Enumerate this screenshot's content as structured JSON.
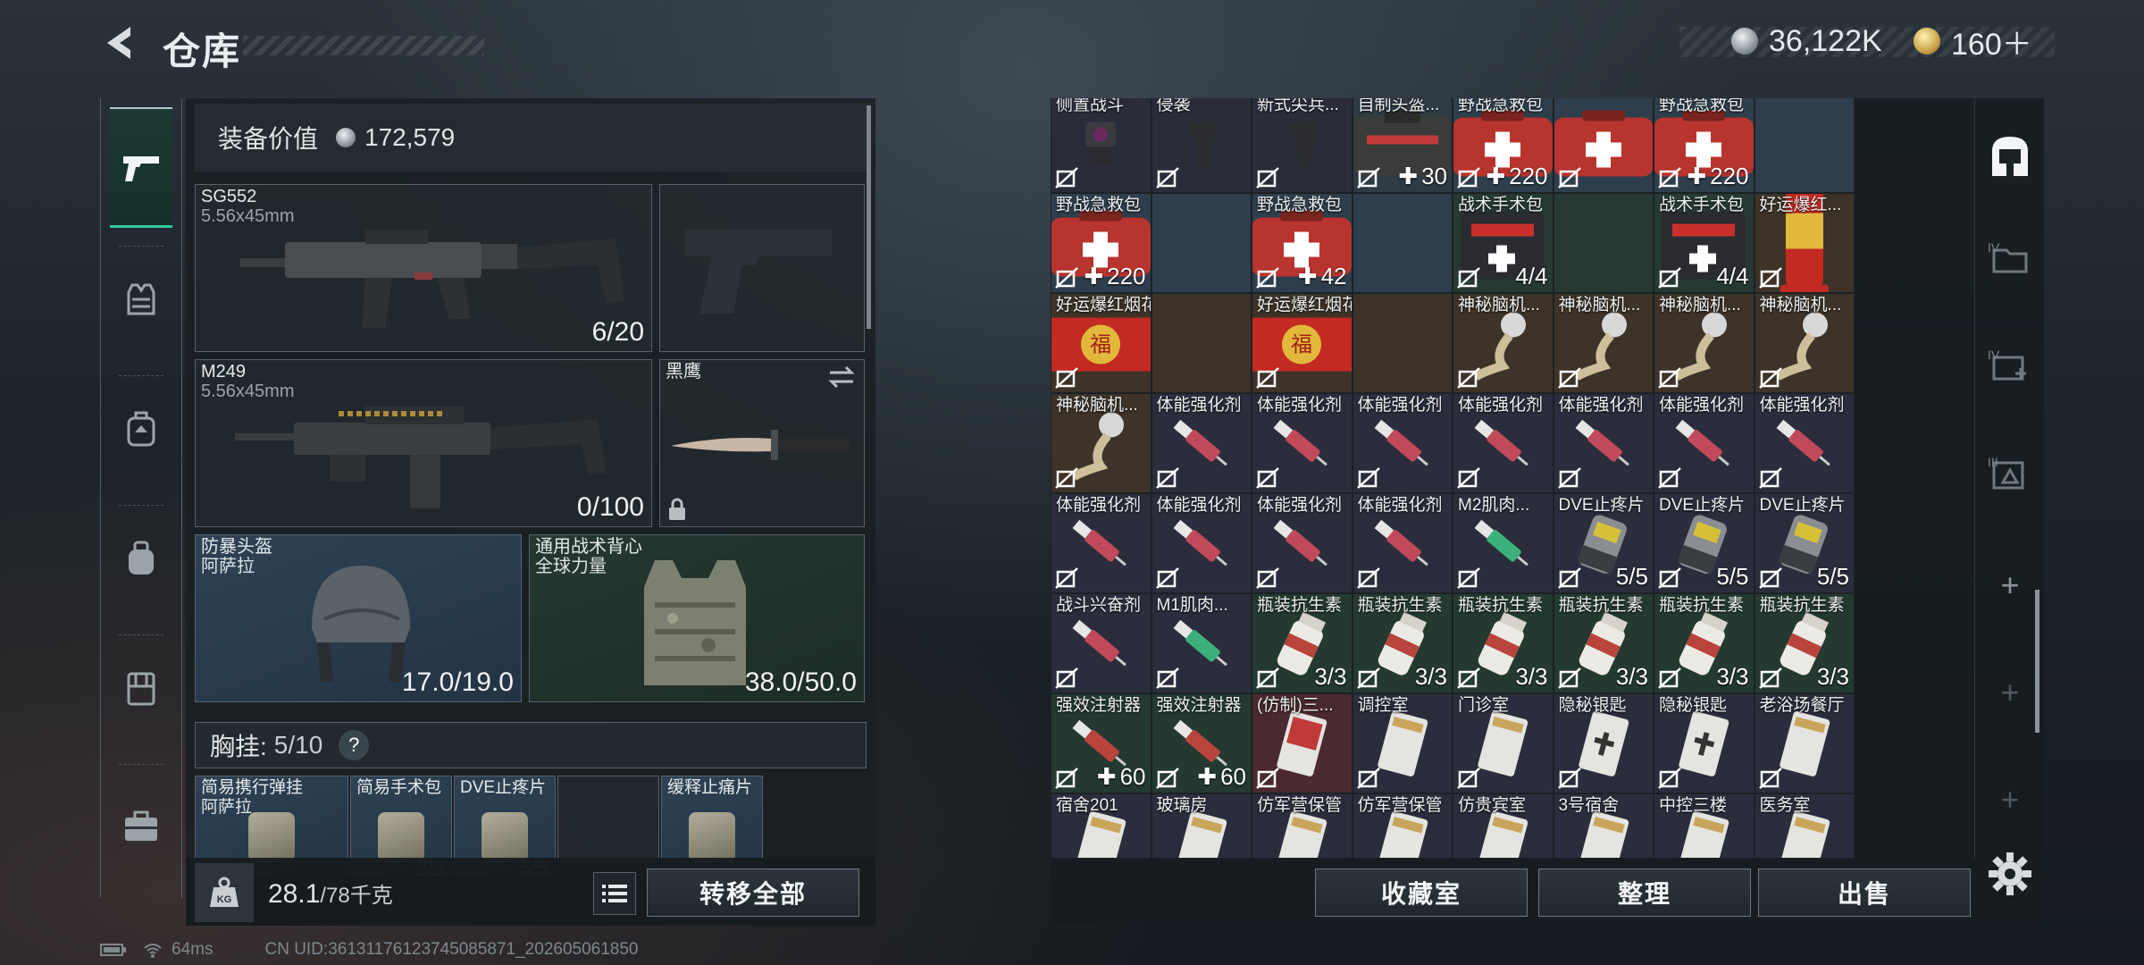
{
  "header": {
    "title": "仓库",
    "silver_amount": "36,122K",
    "gold_amount": "160＋"
  },
  "equipment": {
    "value_label": "装备价值",
    "value": "172,579",
    "primary": {
      "name": "SG552",
      "caliber": "5.56x45mm",
      "ammo": "6/20"
    },
    "secondary": {
      "name": "M249",
      "caliber": "5.56x45mm",
      "ammo": "0/100"
    },
    "melee": {
      "name": "黑鹰"
    },
    "helmet": {
      "name": "防暴头盔",
      "sub": "阿萨拉",
      "durability": "17.0/19.0"
    },
    "vest": {
      "name": "通用战术背心",
      "sub": "全球力量",
      "durability": "38.0/50.0"
    },
    "chest_rig_label": "胸挂:",
    "chest_rig_count": "5/10",
    "help": "?",
    "rig_items": [
      {
        "name": "简易携行弹挂",
        "sub": "阿萨拉",
        "count": ""
      },
      {
        "name": "简易手术包",
        "sub": "",
        "count": "2/2"
      },
      {
        "name": "DVE止疼片",
        "sub": "",
        "count": "5/5"
      },
      {
        "name": "",
        "sub": "",
        "count": ""
      },
      {
        "name": "缓释止痛片",
        "sub": "",
        "count": "1/1"
      }
    ]
  },
  "weight": {
    "current": "28.1",
    "max": "/78千克"
  },
  "buttons": {
    "transfer_all": "转移全部",
    "collection": "收藏室",
    "sort": "整理",
    "sell": "出售"
  },
  "storage_rows": [
    [
      {
        "name": "侧置战斗",
        "count": "",
        "color": "#2a2c3a",
        "icon": "scope"
      },
      {
        "name": "侵袭",
        "count": "",
        "color": "#2a2c3a",
        "icon": "grip"
      },
      {
        "name": "新式尖兵...",
        "count": "",
        "color": "#2a2c3a",
        "icon": "grip"
      },
      {
        "name": "自制头盔...",
        "count": "30",
        "color": "#2e3a44",
        "icon": "armorbag"
      },
      {
        "name": "野战急救包",
        "count": "220",
        "color": "#2e3e4c",
        "icon": "medkit"
      },
      {
        "name": "",
        "count": "",
        "color": "#2e3e4c",
        "icon": "medkit"
      },
      {
        "name": "野战急救包",
        "count": "220",
        "color": "#2e3e4c",
        "icon": "medkit"
      },
      {
        "name": "",
        "count": "",
        "color": "#2e3e4c",
        "icon": ""
      }
    ],
    [
      {
        "name": "野战急救包",
        "count": "220",
        "color": "#2e3e4c",
        "icon": "medkit"
      },
      {
        "name": "",
        "count": "",
        "color": "#2e3e4c",
        "icon": ""
      },
      {
        "name": "野战急救包",
        "count": "42",
        "color": "#2e3e4c",
        "icon": "medkit"
      },
      {
        "name": "",
        "count": "",
        "color": "#2e3e4c",
        "icon": ""
      },
      {
        "name": "战术手术包",
        "count": "4/4",
        "color": "#263a33",
        "icon": "surgery"
      },
      {
        "name": "",
        "count": "",
        "color": "#263a33",
        "icon": ""
      },
      {
        "name": "战术手术包",
        "count": "4/4",
        "color": "#263a33",
        "icon": "surgery"
      },
      {
        "name": "好运爆红...",
        "count": "",
        "color": "#3e3328",
        "icon": "firecracker"
      }
    ],
    [
      {
        "name": "好运爆红烟花",
        "count": "",
        "color": "#3e3328",
        "icon": "firework"
      },
      {
        "name": "",
        "count": "",
        "color": "#3e3328",
        "icon": ""
      },
      {
        "name": "好运爆红烟花",
        "count": "",
        "color": "#3e3328",
        "icon": "firework"
      },
      {
        "name": "",
        "count": "",
        "color": "#3e3328",
        "icon": ""
      },
      {
        "name": "神秘脑机...",
        "count": "",
        "color": "#3e3328",
        "icon": "brain"
      },
      {
        "name": "神秘脑机...",
        "count": "",
        "color": "#3e3328",
        "icon": "brain"
      },
      {
        "name": "神秘脑机...",
        "count": "",
        "color": "#3e3328",
        "icon": "brain"
      },
      {
        "name": "神秘脑机...",
        "count": "",
        "color": "#3e3328",
        "icon": "brain"
      }
    ],
    [
      {
        "name": "神秘脑机...",
        "count": "",
        "color": "#3e3328",
        "icon": "brain"
      },
      {
        "name": "体能强化剂",
        "count": "",
        "color": "#2c2d3c",
        "icon": "syringe"
      },
      {
        "name": "体能强化剂",
        "count": "",
        "color": "#2c2d3c",
        "icon": "syringe"
      },
      {
        "name": "体能强化剂",
        "count": "",
        "color": "#2c2d3c",
        "icon": "syringe"
      },
      {
        "name": "体能强化剂",
        "count": "",
        "color": "#2c2d3c",
        "icon": "syringe"
      },
      {
        "name": "体能强化剂",
        "count": "",
        "color": "#2c2d3c",
        "icon": "syringe"
      },
      {
        "name": "体能强化剂",
        "count": "",
        "color": "#2c2d3c",
        "icon": "syringe"
      },
      {
        "name": "体能强化剂",
        "count": "",
        "color": "#2c2d3c",
        "icon": "syringe"
      }
    ],
    [
      {
        "name": "体能强化剂",
        "count": "",
        "color": "#2c2d3c",
        "icon": "syringe"
      },
      {
        "name": "体能强化剂",
        "count": "",
        "color": "#2c2d3c",
        "icon": "syringe"
      },
      {
        "name": "体能强化剂",
        "count": "",
        "color": "#2c2d3c",
        "icon": "syringe"
      },
      {
        "name": "体能强化剂",
        "count": "",
        "color": "#2c2d3c",
        "icon": "syringe"
      },
      {
        "name": "M2肌肉...",
        "count": "",
        "color": "#2c2d3c",
        "icon": "syringe-green"
      },
      {
        "name": "DVE止疼片",
        "count": "5/5",
        "color": "#2c2d3c",
        "icon": "pills"
      },
      {
        "name": "DVE止疼片",
        "count": "5/5",
        "color": "#2c2d3c",
        "icon": "pills"
      },
      {
        "name": "DVE止疼片",
        "count": "5/5",
        "color": "#2c2d3c",
        "icon": "pills"
      }
    ],
    [
      {
        "name": "战斗兴奋剂",
        "count": "",
        "color": "#2c2d3c",
        "icon": "syringe"
      },
      {
        "name": "M1肌肉...",
        "count": "",
        "color": "#2c2d3c",
        "icon": "syringe-green"
      },
      {
        "name": "瓶装抗生素",
        "count": "3/3",
        "color": "#243a30",
        "icon": "bottle"
      },
      {
        "name": "瓶装抗生素",
        "count": "3/3",
        "color": "#243a30",
        "icon": "bottle"
      },
      {
        "name": "瓶装抗生素",
        "count": "3/3",
        "color": "#243a30",
        "icon": "bottle"
      },
      {
        "name": "瓶装抗生素",
        "count": "3/3",
        "color": "#243a30",
        "icon": "bottle"
      },
      {
        "name": "瓶装抗生素",
        "count": "3/3",
        "color": "#243a30",
        "icon": "bottle"
      },
      {
        "name": "瓶装抗生素",
        "count": "3/3",
        "color": "#243a30",
        "icon": "bottle"
      }
    ],
    [
      {
        "name": "强效注射器",
        "count": "60",
        "color": "#243a30",
        "icon": "injector"
      },
      {
        "name": "强效注射器",
        "count": "60",
        "color": "#243a30",
        "icon": "injector"
      },
      {
        "name": "(仿制)三...",
        "count": "",
        "color": "#4a2a2e",
        "icon": "card-red"
      },
      {
        "name": "调控室",
        "count": "",
        "color": "#2c2d3c",
        "icon": "card"
      },
      {
        "name": "门诊室",
        "count": "",
        "color": "#2c2d3c",
        "icon": "card"
      },
      {
        "name": "隐秘银匙",
        "count": "",
        "color": "#2c2d3c",
        "icon": "card-cross"
      },
      {
        "name": "隐秘银匙",
        "count": "",
        "color": "#2c2d3c",
        "icon": "card-cross"
      },
      {
        "name": "老浴场餐厅",
        "count": "",
        "color": "#2c2d3c",
        "icon": "card"
      }
    ],
    [
      {
        "name": "宿舍201",
        "count": "",
        "color": "#2c2d3c",
        "icon": "card"
      },
      {
        "name": "玻璃房",
        "count": "",
        "color": "#2c2d3c",
        "icon": "card"
      },
      {
        "name": "仿军营保管",
        "count": "",
        "color": "#2c2d3c",
        "icon": "card"
      },
      {
        "name": "仿军营保管",
        "count": "",
        "color": "#2c2d3c",
        "icon": "card"
      },
      {
        "name": "仿贵宾室",
        "count": "",
        "color": "#2c2d3c",
        "icon": "card"
      },
      {
        "name": "3号宿舍",
        "count": "",
        "color": "#2c2d3c",
        "icon": "card"
      },
      {
        "name": "中控三楼",
        "count": "",
        "color": "#2c2d3c",
        "icon": "card"
      },
      {
        "name": "医务室",
        "count": "",
        "color": "#2c2d3c",
        "icon": "card"
      }
    ]
  ],
  "right_nav": [
    "IV",
    "IV",
    "III"
  ],
  "status": {
    "ping": "64ms",
    "uid": "CN UID:36131176123745085871_202605061850"
  },
  "colors": {
    "accent": "#34c79a",
    "bg": "#1d252b"
  }
}
